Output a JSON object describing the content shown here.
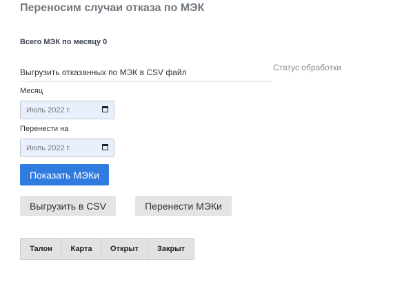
{
  "page": {
    "title": "Переносим случаи отказа по МЭК",
    "total_label": "Всего МЭК по месяцу 0",
    "export_label": "Выгрузить отказанных по МЭК в CSV файл",
    "status_label": "Статус обработки"
  },
  "form": {
    "month_label": "Месяц",
    "month_value": "Июль 2022 г.",
    "transfer_label": "Перенести на",
    "transfer_value": "Июль 2022 г."
  },
  "buttons": {
    "show": "Показать МЭКи",
    "export_csv": "Выгрузить в CSV",
    "transfer": "Перенести МЭКи"
  },
  "table": {
    "columns": [
      "Талон",
      "Карта",
      "Открыт",
      "Закрыт"
    ]
  },
  "icons": {
    "calendar": "calendar-icon"
  },
  "colors": {
    "primary": "#2f7be0",
    "secondary_button": "#e4e4e4",
    "input_bg": "#e8f0fe"
  }
}
